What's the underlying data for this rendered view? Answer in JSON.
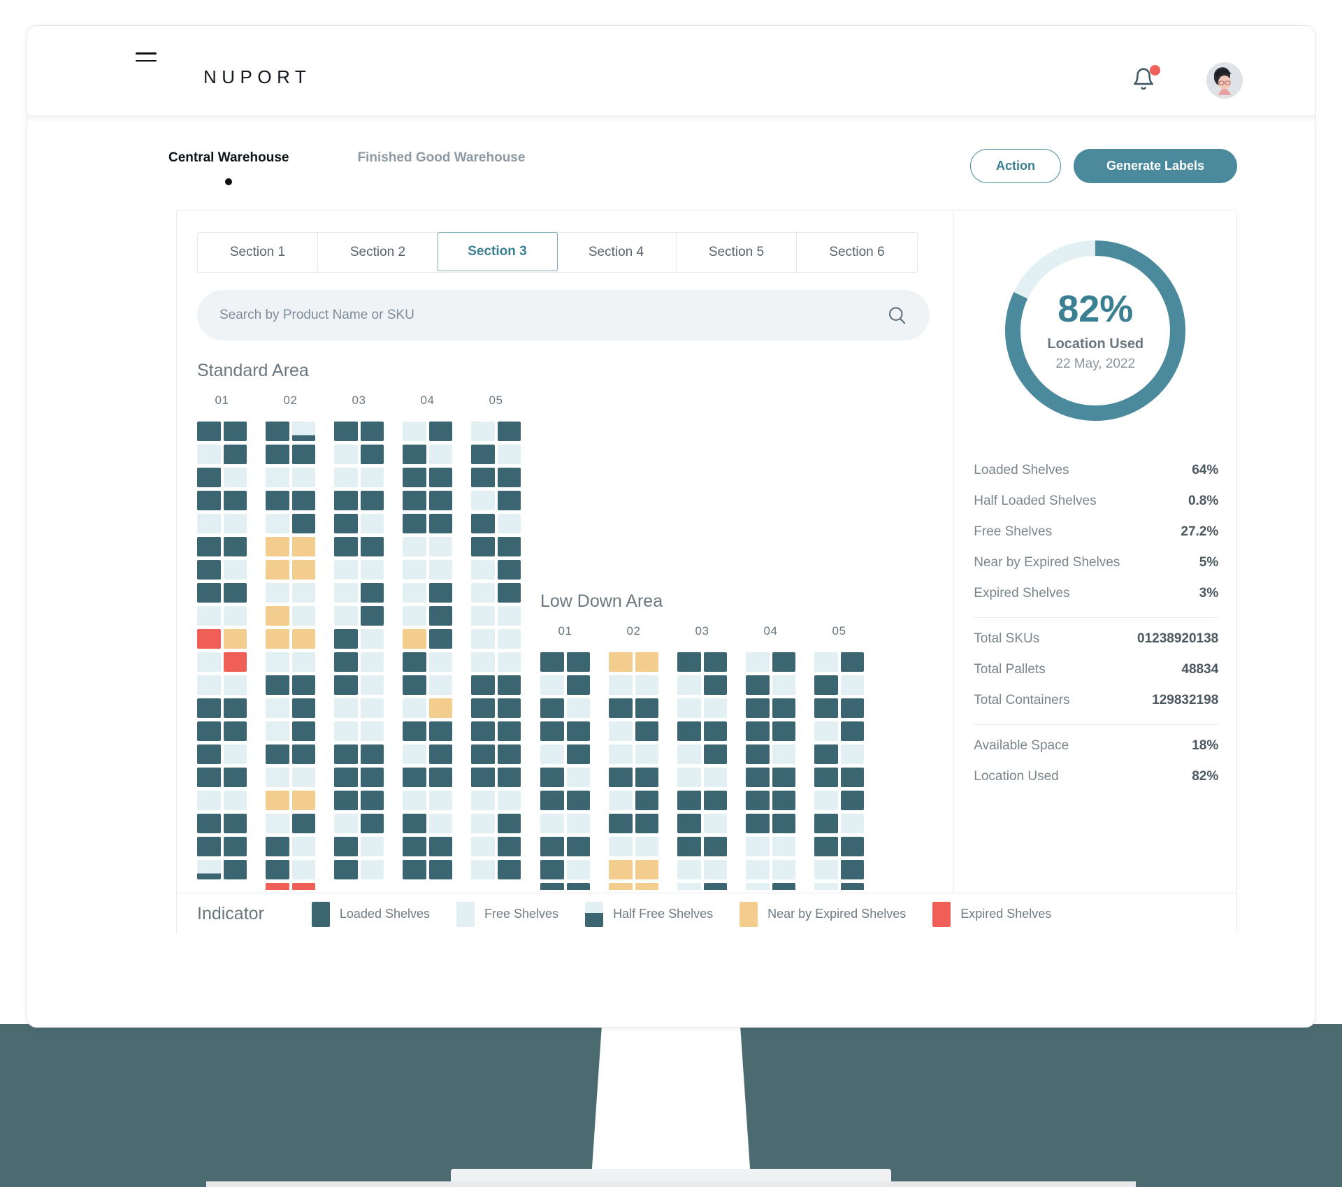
{
  "brand": {
    "name": "NUPORT",
    "menu_icon": "hamburger-icon",
    "bell_icon": "bell-icon",
    "avatar_icon": "user-avatar"
  },
  "warehouse_tabs": [
    {
      "label": "Central Warehouse",
      "active": true
    },
    {
      "label": "Finished Good Warehouse",
      "active": false
    }
  ],
  "actions": {
    "action_label": "Action",
    "generate_label": "Generate Labels"
  },
  "section_tabs": [
    {
      "label": "Section 1",
      "active": false
    },
    {
      "label": "Section 2",
      "active": false
    },
    {
      "label": "Section 3",
      "active": true
    },
    {
      "label": "Section 4",
      "active": false
    },
    {
      "label": "Section 5",
      "active": false
    },
    {
      "label": "Section 6",
      "active": false
    }
  ],
  "search": {
    "placeholder": "Search by Product Name or SKU",
    "value": "",
    "icon": "search-icon"
  },
  "donut": {
    "percent": "82%",
    "label": "Location Used",
    "date": "22 May, 2022",
    "value": 82,
    "used_color": "#4b8a9c",
    "free_color": "#e2eff3"
  },
  "stats": [
    {
      "key": "Loaded Shelves",
      "value": "64%"
    },
    {
      "key": "Half Loaded Shelves",
      "value": "0.8%"
    },
    {
      "key": "Free Shelves",
      "value": "27.2%"
    },
    {
      "key": "Near by Expired Shelves",
      "value": "5%"
    },
    {
      "key": "Expired Shelves",
      "value": "3%"
    }
  ],
  "totals": [
    {
      "key": "Total SKUs",
      "value": "01238920138"
    },
    {
      "key": "Total Pallets",
      "value": "48834"
    },
    {
      "key": "Total Containers",
      "value": "129832198"
    }
  ],
  "space": [
    {
      "key": "Available Space",
      "value": "18%"
    },
    {
      "key": "Location Used",
      "value": "82%"
    }
  ],
  "indicator": {
    "title": "Indicator",
    "items": [
      {
        "label": "Loaded Shelves",
        "color": "#3b6571",
        "kind": "loaded"
      },
      {
        "label": "Free Shelves",
        "color": "#e2eff3",
        "kind": "free"
      },
      {
        "label": "Half Free Shelves",
        "color": "#3b6571",
        "kind": "halffree"
      },
      {
        "label": "Near by Expired Shelves",
        "color": "#f2cd8e",
        "kind": "near"
      },
      {
        "label": "Expired Shelves",
        "color": "#ef5f58",
        "kind": "expired"
      }
    ]
  },
  "chart_data": {
    "type": "heatmap",
    "title": "Warehouse Shelf Occupancy Map",
    "legend_position": "bottom",
    "palette": {
      "loaded": "#3b6571",
      "free": "#e2eff3",
      "halffree": "#3b6571",
      "near": "#f2cd8e",
      "expired": "#ef5f58"
    },
    "areas": [
      {
        "name": "Standard Area",
        "columns": [
          "01",
          "02",
          "03",
          "04",
          "05"
        ],
        "cells_per_row": 2,
        "rows": 20,
        "data": {
          "01": [
            [
              "loaded",
              "loaded"
            ],
            [
              "free",
              "loaded"
            ],
            [
              "loaded",
              "free"
            ],
            [
              "loaded",
              "loaded"
            ],
            [
              "free",
              "free"
            ],
            [
              "loaded",
              "loaded"
            ],
            [
              "loaded",
              "free"
            ],
            [
              "loaded",
              "loaded"
            ],
            [
              "free",
              "free"
            ],
            [
              "expired",
              "near"
            ],
            [
              "free",
              "expired"
            ],
            [
              "free",
              "free"
            ],
            [
              "loaded",
              "loaded"
            ],
            [
              "loaded",
              "loaded"
            ],
            [
              "loaded",
              "free"
            ],
            [
              "loaded",
              "loaded"
            ],
            [
              "free",
              "free"
            ],
            [
              "loaded",
              "loaded"
            ],
            [
              "loaded",
              "loaded"
            ],
            [
              "halfloaded",
              "loaded"
            ]
          ],
          "02": [
            [
              "loaded",
              "halfloaded"
            ],
            [
              "loaded",
              "loaded"
            ],
            [
              "free",
              "free"
            ],
            [
              "loaded",
              "loaded"
            ],
            [
              "free",
              "loaded"
            ],
            [
              "near",
              "near"
            ],
            [
              "near",
              "near"
            ],
            [
              "free",
              "free"
            ],
            [
              "near",
              "free"
            ],
            [
              "near",
              "near"
            ],
            [
              "free",
              "free"
            ],
            [
              "loaded",
              "loaded"
            ],
            [
              "free",
              "loaded"
            ],
            [
              "free",
              "loaded"
            ],
            [
              "loaded",
              "loaded"
            ],
            [
              "free",
              "free"
            ],
            [
              "near",
              "near"
            ],
            [
              "free",
              "loaded"
            ],
            [
              "loaded",
              "free"
            ],
            [
              "loaded",
              "free"
            ],
            [
              "expired",
              "expired"
            ]
          ],
          "03": [
            [
              "loaded",
              "loaded"
            ],
            [
              "free",
              "loaded"
            ],
            [
              "free",
              "free"
            ],
            [
              "loaded",
              "loaded"
            ],
            [
              "loaded",
              "free"
            ],
            [
              "loaded",
              "loaded"
            ],
            [
              "free",
              "free"
            ],
            [
              "free",
              "loaded"
            ],
            [
              "free",
              "loaded"
            ],
            [
              "loaded",
              "free"
            ],
            [
              "loaded",
              "free"
            ],
            [
              "loaded",
              "free"
            ],
            [
              "free",
              "free"
            ],
            [
              "free",
              "free"
            ],
            [
              "loaded",
              "loaded"
            ],
            [
              "loaded",
              "loaded"
            ],
            [
              "loaded",
              "loaded"
            ],
            [
              "free",
              "loaded"
            ],
            [
              "loaded",
              "free"
            ],
            [
              "loaded",
              "free"
            ]
          ],
          "04": [
            [
              "free",
              "loaded"
            ],
            [
              "loaded",
              "free"
            ],
            [
              "loaded",
              "loaded"
            ],
            [
              "loaded",
              "loaded"
            ],
            [
              "loaded",
              "loaded"
            ],
            [
              "free",
              "free"
            ],
            [
              "free",
              "free"
            ],
            [
              "free",
              "loaded"
            ],
            [
              "free",
              "loaded"
            ],
            [
              "near",
              "loaded"
            ],
            [
              "loaded",
              "free"
            ],
            [
              "loaded",
              "free"
            ],
            [
              "free",
              "near"
            ],
            [
              "loaded",
              "loaded"
            ],
            [
              "free",
              "loaded"
            ],
            [
              "loaded",
              "loaded"
            ],
            [
              "free",
              "free"
            ],
            [
              "loaded",
              "free"
            ],
            [
              "loaded",
              "loaded"
            ],
            [
              "loaded",
              "loaded"
            ]
          ],
          "05": [
            [
              "free",
              "loaded"
            ],
            [
              "loaded",
              "free"
            ],
            [
              "loaded",
              "loaded"
            ],
            [
              "free",
              "loaded"
            ],
            [
              "loaded",
              "free"
            ],
            [
              "loaded",
              "loaded"
            ],
            [
              "free",
              "loaded"
            ],
            [
              "free",
              "loaded"
            ],
            [
              "free",
              "free"
            ],
            [
              "free",
              "free"
            ],
            [
              "free",
              "free"
            ],
            [
              "loaded",
              "loaded"
            ],
            [
              "loaded",
              "loaded"
            ],
            [
              "loaded",
              "loaded"
            ],
            [
              "loaded",
              "loaded"
            ],
            [
              "loaded",
              "loaded"
            ],
            [
              "free",
              "free"
            ],
            [
              "free",
              "loaded"
            ],
            [
              "free",
              "loaded"
            ],
            [
              "free",
              "loaded"
            ]
          ]
        }
      },
      {
        "name": "Low Down Area",
        "columns": [
          "01",
          "02",
          "03",
          "04",
          "05"
        ],
        "cells_per_row": 2,
        "rows": 11,
        "data": {
          "01": [
            [
              "loaded",
              "loaded"
            ],
            [
              "free",
              "loaded"
            ],
            [
              "loaded",
              "free"
            ],
            [
              "loaded",
              "loaded"
            ],
            [
              "free",
              "loaded"
            ],
            [
              "loaded",
              "free"
            ],
            [
              "loaded",
              "loaded"
            ],
            [
              "free",
              "free"
            ],
            [
              "loaded",
              "loaded"
            ],
            [
              "loaded",
              "free"
            ],
            [
              "loaded",
              "loaded"
            ]
          ],
          "02": [
            [
              "near",
              "near"
            ],
            [
              "free",
              "free"
            ],
            [
              "loaded",
              "loaded"
            ],
            [
              "free",
              "loaded"
            ],
            [
              "free",
              "free"
            ],
            [
              "loaded",
              "loaded"
            ],
            [
              "free",
              "loaded"
            ],
            [
              "loaded",
              "loaded"
            ],
            [
              "free",
              "free"
            ],
            [
              "near",
              "near"
            ],
            [
              "near",
              "near"
            ]
          ],
          "03": [
            [
              "loaded",
              "loaded"
            ],
            [
              "free",
              "loaded"
            ],
            [
              "free",
              "free"
            ],
            [
              "loaded",
              "loaded"
            ],
            [
              "free",
              "loaded"
            ],
            [
              "free",
              "free"
            ],
            [
              "loaded",
              "loaded"
            ],
            [
              "loaded",
              "free"
            ],
            [
              "loaded",
              "loaded"
            ],
            [
              "free",
              "free"
            ],
            [
              "free",
              "loaded"
            ]
          ],
          "04": [
            [
              "free",
              "loaded"
            ],
            [
              "loaded",
              "free"
            ],
            [
              "loaded",
              "loaded"
            ],
            [
              "loaded",
              "loaded"
            ],
            [
              "loaded",
              "free"
            ],
            [
              "loaded",
              "loaded"
            ],
            [
              "loaded",
              "loaded"
            ],
            [
              "loaded",
              "loaded"
            ],
            [
              "free",
              "free"
            ],
            [
              "free",
              "free"
            ],
            [
              "free",
              "loaded"
            ]
          ],
          "05": [
            [
              "free",
              "loaded"
            ],
            [
              "loaded",
              "free"
            ],
            [
              "loaded",
              "loaded"
            ],
            [
              "free",
              "loaded"
            ],
            [
              "loaded",
              "free"
            ],
            [
              "loaded",
              "loaded"
            ],
            [
              "free",
              "loaded"
            ],
            [
              "loaded",
              "free"
            ],
            [
              "loaded",
              "loaded"
            ],
            [
              "free",
              "loaded"
            ],
            [
              "free",
              "loaded"
            ]
          ]
        }
      }
    ]
  }
}
